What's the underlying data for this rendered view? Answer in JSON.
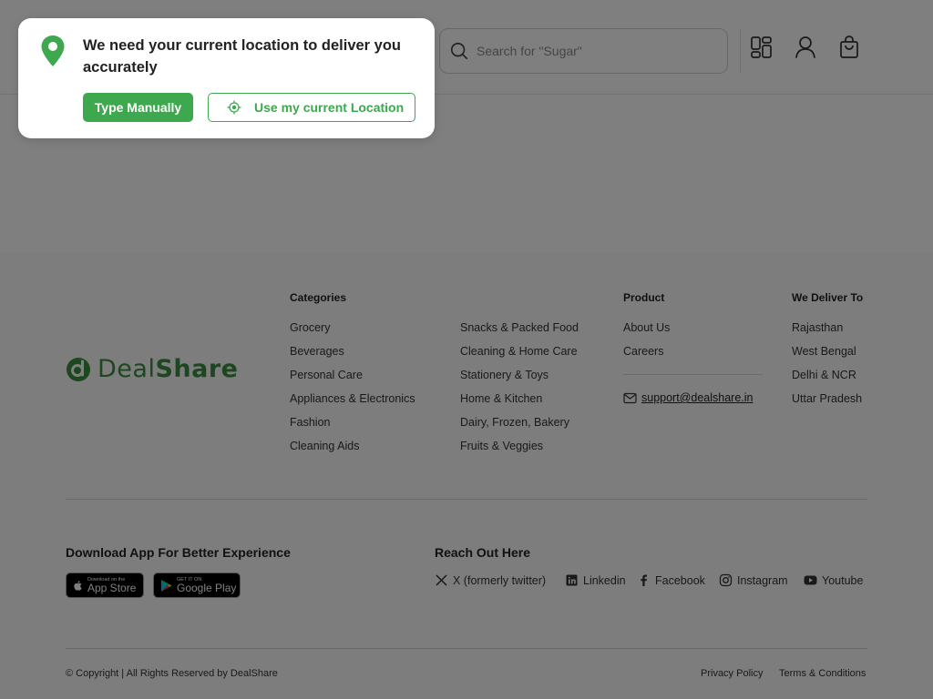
{
  "header": {
    "search_placeholder": "Search for \"Sugar\""
  },
  "location_popup": {
    "message": "We need your current location to deliver you accurately",
    "type_manually_label": "Type Manually",
    "use_current_label": "Use my current Location"
  },
  "footer": {
    "brand": {
      "part1": "Deal",
      "part2": "Share"
    },
    "categories": {
      "title": "Categories",
      "col1": [
        "Grocery",
        "Beverages",
        "Personal Care",
        "Appliances & Electronics",
        "Fashion",
        "Cleaning Aids"
      ],
      "col2": [
        "Snacks & Packed Food",
        "Cleaning & Home Care",
        "Stationery & Toys",
        "Home & Kitchen",
        "Dairy, Frozen, Bakery",
        "Fruits & Veggies"
      ]
    },
    "product": {
      "title": "Product",
      "items": [
        "About Us",
        "Careers"
      ],
      "email": "support@dealshare.in"
    },
    "deliver": {
      "title": "We Deliver To",
      "items": [
        "Rajasthan",
        "West Bengal",
        "Delhi & NCR",
        "Uttar Pradesh"
      ]
    },
    "download": {
      "title": "Download App For Better Experience",
      "app_store_small": "Download on the",
      "app_store_big": "App Store",
      "google_play_small": "GET IT ON",
      "google_play_big": "Google Play"
    },
    "reach": {
      "title": "Reach Out Here",
      "links": [
        "X (formerly twitter)",
        "Linkedin",
        "Facebook",
        "Instagram",
        "Youtube"
      ]
    },
    "copyright": "© Copyright | All Rights Reserved by DealShare",
    "privacy": "Privacy Policy",
    "terms": "Terms & Conditions"
  },
  "colors": {
    "brand_green": "#3da84d",
    "overlay": "rgba(0,0,0,0.5)"
  }
}
